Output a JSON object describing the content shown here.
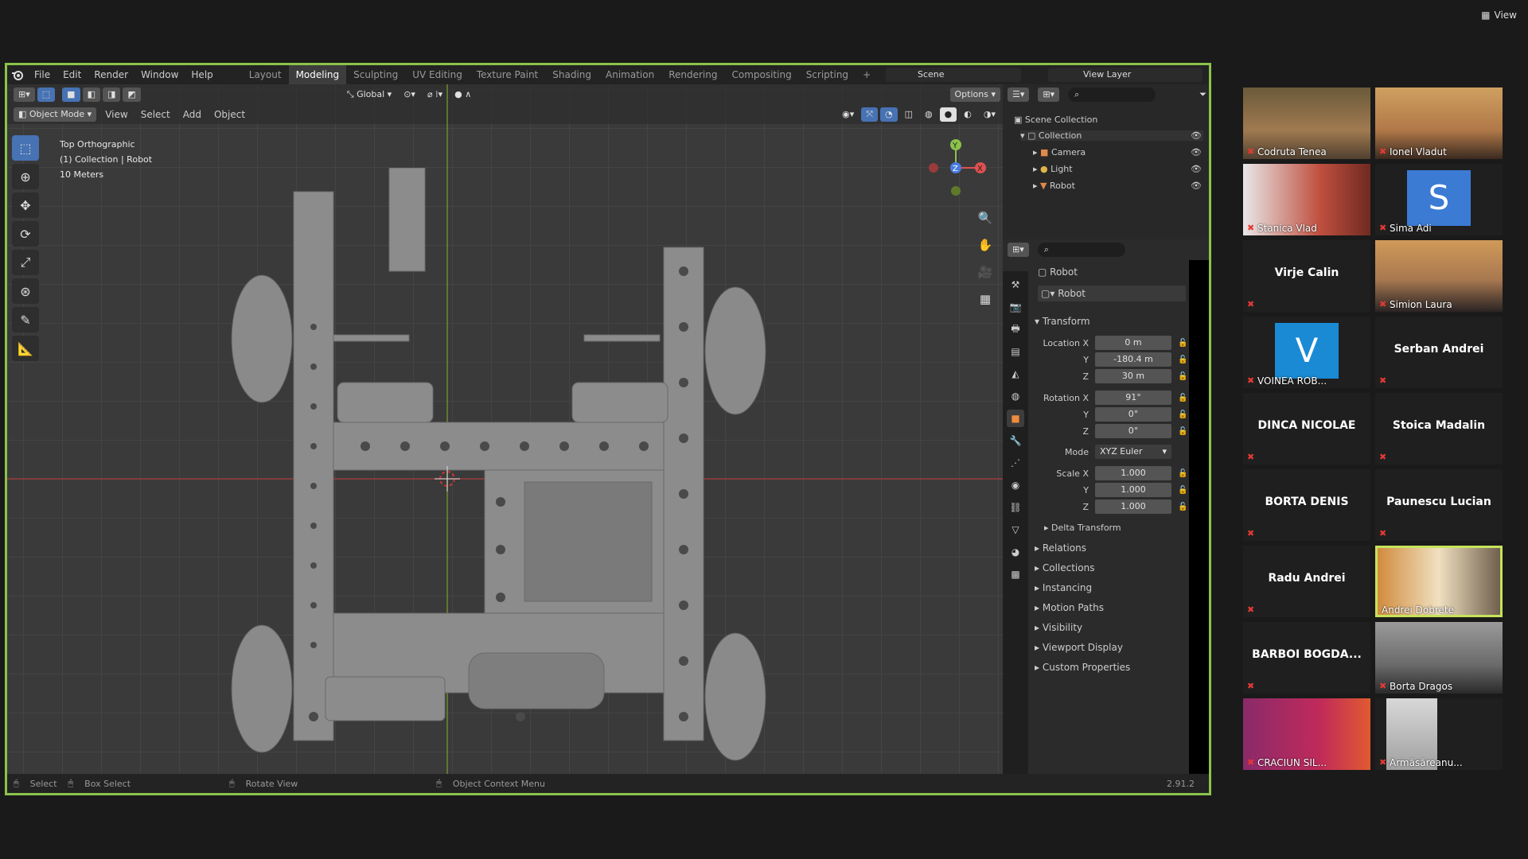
{
  "top_right": {
    "view_label": "View"
  },
  "menu": [
    "File",
    "Edit",
    "Render",
    "Window",
    "Help"
  ],
  "workspaces": [
    "Layout",
    "Modeling",
    "Sculpting",
    "UV Editing",
    "Texture Paint",
    "Shading",
    "Animation",
    "Rendering",
    "Compositing",
    "Scripting",
    "+"
  ],
  "scene": "Scene",
  "view_layer": "View Layer",
  "header": {
    "transform_orientation": "Global",
    "options": "Options"
  },
  "mode_bar": {
    "mode": "Object Mode",
    "view": "View",
    "select": "Select",
    "add": "Add",
    "object": "Object"
  },
  "overlay": {
    "line1": "Top Orthographic",
    "line2": "(1) Collection | Robot",
    "line3": "10 Meters"
  },
  "outliner": {
    "root": "Scene Collection",
    "collection": "Collection",
    "items": [
      "Camera",
      "Light",
      "Robot"
    ]
  },
  "properties": {
    "object_name": "Robot",
    "data_name": "Robot",
    "transform": "Transform",
    "location": {
      "label": "Location X",
      "x": "0 m",
      "y": "-180.4 m",
      "z": "30 m"
    },
    "rotation": {
      "label": "Rotation X",
      "x": "91°",
      "y": "0°",
      "z": "0°"
    },
    "mode": {
      "label": "Mode",
      "value": "XYZ Euler"
    },
    "scale": {
      "label": "Scale X",
      "x": "1.000",
      "y": "1.000",
      "z": "1.000"
    },
    "axis_y": "Y",
    "axis_z": "Z",
    "sections": [
      "Delta Transform",
      "Relations",
      "Collections",
      "Instancing",
      "Motion Paths",
      "Visibility",
      "Viewport Display",
      "Custom Properties"
    ]
  },
  "status": {
    "select": "Select",
    "box_select": "Box Select",
    "rotate": "Rotate View",
    "context": "Object Context Menu",
    "version": "2.91.2"
  },
  "participants": [
    {
      "name": "Codruta Tenea",
      "type": "video"
    },
    {
      "name": "Ionel Vladut",
      "type": "video"
    },
    {
      "name": "Stanica Vlad",
      "type": "video"
    },
    {
      "name": "Sima Adi",
      "type": "avatar",
      "letter": "S"
    },
    {
      "name": "Virje Calin",
      "type": "name"
    },
    {
      "name": "Simion Laura",
      "type": "video"
    },
    {
      "name": "VOINEA ROB...",
      "type": "avatar",
      "letter": "V"
    },
    {
      "name": "Serban Andrei",
      "type": "name"
    },
    {
      "name": "DINCA NICOLAE",
      "type": "name"
    },
    {
      "name": "Stoica Madalin",
      "type": "name"
    },
    {
      "name": "BORTA DENIS",
      "type": "name"
    },
    {
      "name": "Paunescu Lucian",
      "type": "name"
    },
    {
      "name": "Radu Andrei",
      "type": "name"
    },
    {
      "name": "Andrei Dobrete",
      "type": "video"
    },
    {
      "name": "BARBOI BOGDA...",
      "type": "name"
    },
    {
      "name": "Borta Dragos",
      "type": "video"
    },
    {
      "name": "CRACIUN SIL...",
      "type": "video"
    },
    {
      "name": "Armăsăreanu...",
      "type": "video"
    }
  ],
  "colors": {
    "active_speaker": "#c6e35a",
    "window_border": "#8bc34a",
    "muted": "#e53935"
  }
}
